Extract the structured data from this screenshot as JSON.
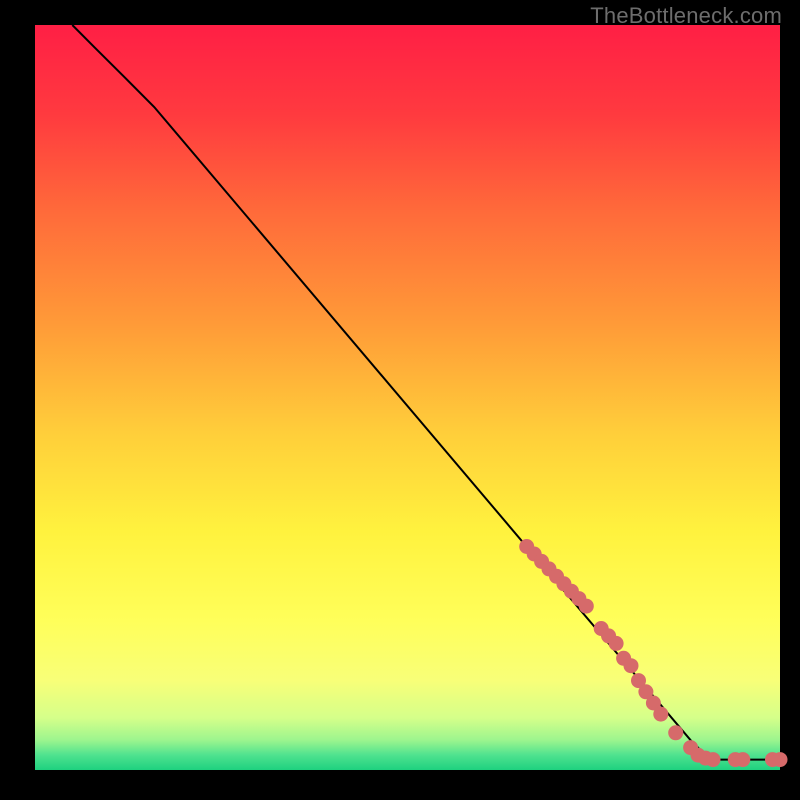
{
  "watermark": "TheBottleneck.com",
  "plot": {
    "gradient_stops": [
      {
        "pct": 0,
        "color": "#ff1f45"
      },
      {
        "pct": 12,
        "color": "#ff3a3f"
      },
      {
        "pct": 25,
        "color": "#ff6a3a"
      },
      {
        "pct": 40,
        "color": "#ff9a38"
      },
      {
        "pct": 55,
        "color": "#ffcf3a"
      },
      {
        "pct": 68,
        "color": "#fff23e"
      },
      {
        "pct": 80,
        "color": "#ffff5a"
      },
      {
        "pct": 88,
        "color": "#f8ff78"
      },
      {
        "pct": 93,
        "color": "#d5ff8a"
      },
      {
        "pct": 96,
        "color": "#9cf58e"
      },
      {
        "pct": 98,
        "color": "#4fe28f"
      },
      {
        "pct": 100,
        "color": "#1ed17f"
      }
    ]
  },
  "chart_data": {
    "type": "line",
    "title": "",
    "xlabel": "",
    "ylabel": "",
    "xlim": [
      0,
      100
    ],
    "ylim": [
      0,
      100
    ],
    "curve": [
      {
        "x": 5,
        "y": 100
      },
      {
        "x": 8,
        "y": 97
      },
      {
        "x": 12,
        "y": 93
      },
      {
        "x": 16,
        "y": 89
      },
      {
        "x": 88,
        "y": 4
      },
      {
        "x": 90,
        "y": 2
      },
      {
        "x": 91,
        "y": 1.4
      },
      {
        "x": 100,
        "y": 1.4
      }
    ],
    "scatter": [
      {
        "x": 66,
        "y": 30
      },
      {
        "x": 67,
        "y": 29
      },
      {
        "x": 68,
        "y": 28
      },
      {
        "x": 69,
        "y": 27
      },
      {
        "x": 70,
        "y": 26
      },
      {
        "x": 71,
        "y": 25
      },
      {
        "x": 72,
        "y": 24
      },
      {
        "x": 73,
        "y": 23
      },
      {
        "x": 74,
        "y": 22
      },
      {
        "x": 76,
        "y": 19
      },
      {
        "x": 77,
        "y": 18
      },
      {
        "x": 78,
        "y": 17
      },
      {
        "x": 79,
        "y": 15
      },
      {
        "x": 80,
        "y": 14
      },
      {
        "x": 81,
        "y": 12
      },
      {
        "x": 82,
        "y": 10.5
      },
      {
        "x": 83,
        "y": 9
      },
      {
        "x": 84,
        "y": 7.5
      },
      {
        "x": 86,
        "y": 5
      },
      {
        "x": 88,
        "y": 3
      },
      {
        "x": 89,
        "y": 2
      },
      {
        "x": 90,
        "y": 1.6
      },
      {
        "x": 91,
        "y": 1.4
      },
      {
        "x": 94,
        "y": 1.4
      },
      {
        "x": 95,
        "y": 1.4
      },
      {
        "x": 99,
        "y": 1.4
      },
      {
        "x": 100,
        "y": 1.4
      }
    ]
  }
}
